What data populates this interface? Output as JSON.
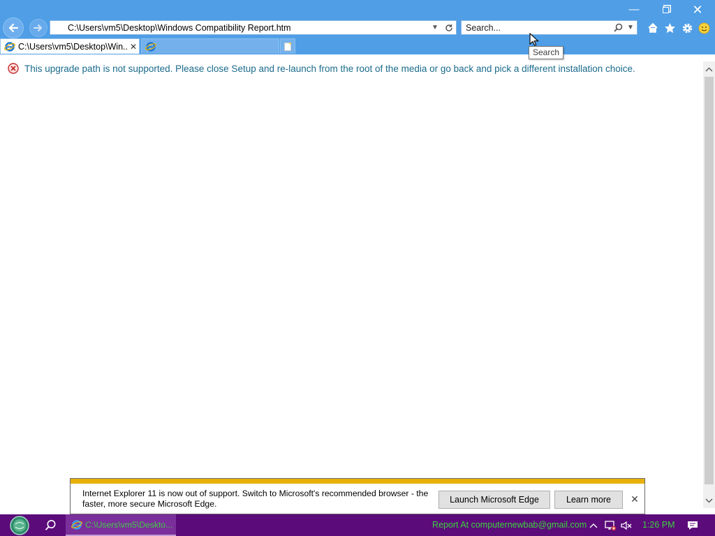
{
  "window": {
    "minimize_glyph": "—",
    "close_glyph": "✕"
  },
  "address_bar": {
    "url": "C:\\Users\\vm5\\Desktop\\Windows Compatibility Report.htm"
  },
  "search_box": {
    "placeholder": "Search...",
    "tooltip": "Search"
  },
  "tabs": [
    {
      "title": "C:\\Users\\vm5\\Desktop\\Win...",
      "active": true,
      "close_glyph": "✕"
    },
    {
      "title": "",
      "active": false
    }
  ],
  "toolbar_icons": [
    "home-icon",
    "favorites-star-icon",
    "settings-gear-icon",
    "feedback-smiley-icon"
  ],
  "page": {
    "error_message": "This upgrade path is not supported. Please close Setup and re-launch from the root of the media or go back and pick a different installation choice."
  },
  "notification": {
    "text": "Internet Explorer 11 is now out of support. Switch to Microsoft's recommended browser - the faster, more secure Microsoft Edge.",
    "launch_button": "Launch Microsoft Edge",
    "learn_button": "Learn more",
    "close_glyph": "✕"
  },
  "taskbar": {
    "app_title": "C:\\Users\\vm5\\Deskto...",
    "report_text": "Report At computernewbab@gmail.com",
    "clock": "1:26 PM"
  },
  "colors": {
    "chrome": "#4f9ee6",
    "error_text": "#1a6b8c",
    "notification_stripe": "#e8b008",
    "taskbar": "#5b0b7a",
    "taskbar_text": "#3fd13f"
  }
}
